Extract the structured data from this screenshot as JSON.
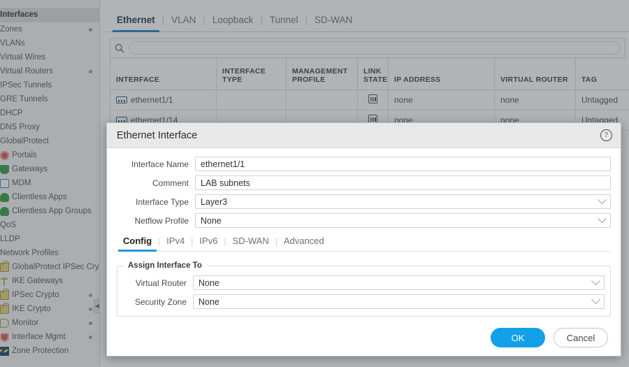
{
  "sidebar": {
    "header": "Interfaces",
    "items": [
      {
        "label": "Zones",
        "icon": "",
        "dot": true
      },
      {
        "label": "VLANs",
        "icon": "",
        "dot": false
      },
      {
        "label": "Virtual Wires",
        "icon": "",
        "dot": false
      },
      {
        "label": "Virtual Routers",
        "icon": "",
        "dot": true
      },
      {
        "label": "IPSec Tunnels",
        "icon": "",
        "dot": false
      },
      {
        "label": "GRE Tunnels",
        "icon": "",
        "dot": false
      },
      {
        "label": "DHCP",
        "icon": "",
        "dot": false
      },
      {
        "label": "DNS Proxy",
        "icon": "",
        "dot": false
      },
      {
        "label": "GlobalProtect",
        "icon": "",
        "dot": false
      },
      {
        "label": "Portals",
        "icon": "portal-icon",
        "dot": false
      },
      {
        "label": "Gateways",
        "icon": "gateway-icon",
        "dot": false
      },
      {
        "label": "MDM",
        "icon": "mdm-icon",
        "dot": false
      },
      {
        "label": "Clientless Apps",
        "icon": "clientless-apps-icon",
        "dot": false
      },
      {
        "label": "Clientless App Groups",
        "icon": "clientless-app-groups-icon",
        "dot": false
      },
      {
        "label": "QoS",
        "icon": "",
        "dot": false
      },
      {
        "label": "LLDP",
        "icon": "",
        "dot": false
      },
      {
        "label": "Network Profiles",
        "icon": "",
        "dot": false
      },
      {
        "label": "GlobalProtect IPSec Crypto",
        "icon": "lock-icon",
        "dot": false
      },
      {
        "label": "IKE Gateways",
        "icon": "key-icon",
        "dot": false
      },
      {
        "label": "IPSec Crypto",
        "icon": "lock-icon",
        "dot": true
      },
      {
        "label": "IKE Crypto",
        "icon": "lock-icon",
        "dot": true
      },
      {
        "label": "Monitor",
        "icon": "monitor-icon",
        "dot": true
      },
      {
        "label": "Interface Mgmt",
        "icon": "shield-icon",
        "dot": true
      },
      {
        "label": "Zone Protection",
        "icon": "zone-protection-icon",
        "dot": false
      }
    ]
  },
  "tabs": [
    {
      "label": "Ethernet",
      "active": true
    },
    {
      "label": "VLAN",
      "active": false
    },
    {
      "label": "Loopback",
      "active": false
    },
    {
      "label": "Tunnel",
      "active": false
    },
    {
      "label": "SD-WAN",
      "active": false
    }
  ],
  "search": {
    "value": "",
    "placeholder": ""
  },
  "table": {
    "columns": [
      "INTERFACE",
      "INTERFACE TYPE",
      "MANAGEMENT PROFILE",
      "LINK STATE",
      "IP ADDRESS",
      "VIRTUAL ROUTER",
      "TAG"
    ],
    "rows": [
      {
        "interface": "ethernet1/1",
        "interface_type": "",
        "management_profile": "",
        "link_state": "link-state-icon",
        "ip_address": "none",
        "virtual_router": "none",
        "tag": "Untagged"
      },
      {
        "interface": "ethernet1/14",
        "interface_type": "",
        "management_profile": "",
        "link_state": "link-state-icon",
        "ip_address": "none",
        "virtual_router": "none",
        "tag": "Untagged"
      }
    ]
  },
  "modal": {
    "title": "Ethernet Interface",
    "help_icon": "help-icon",
    "fields": {
      "interface_name_label": "Interface Name",
      "interface_name_value": "ethernet1/1",
      "comment_label": "Comment",
      "comment_value": "LAB subnets",
      "interface_type_label": "Interface Type",
      "interface_type_value": "Layer3",
      "netflow_profile_label": "Netflow Profile",
      "netflow_profile_value": "None"
    },
    "tabs": [
      {
        "label": "Config",
        "active": true
      },
      {
        "label": "IPv4",
        "active": false
      },
      {
        "label": "IPv6",
        "active": false
      },
      {
        "label": "SD-WAN",
        "active": false
      },
      {
        "label": "Advanced",
        "active": false
      }
    ],
    "assign": {
      "legend": "Assign Interface To",
      "virtual_router_label": "Virtual Router",
      "virtual_router_value": "None",
      "security_zone_label": "Security Zone",
      "security_zone_value": "None"
    },
    "ok_label": "OK",
    "cancel_label": "Cancel"
  },
  "colors": {
    "accent_blue": "#1a7fc1",
    "button_blue": "#12a0e8",
    "link_blue": "#1a6a9b",
    "modal_header": "#e8e8e8"
  }
}
